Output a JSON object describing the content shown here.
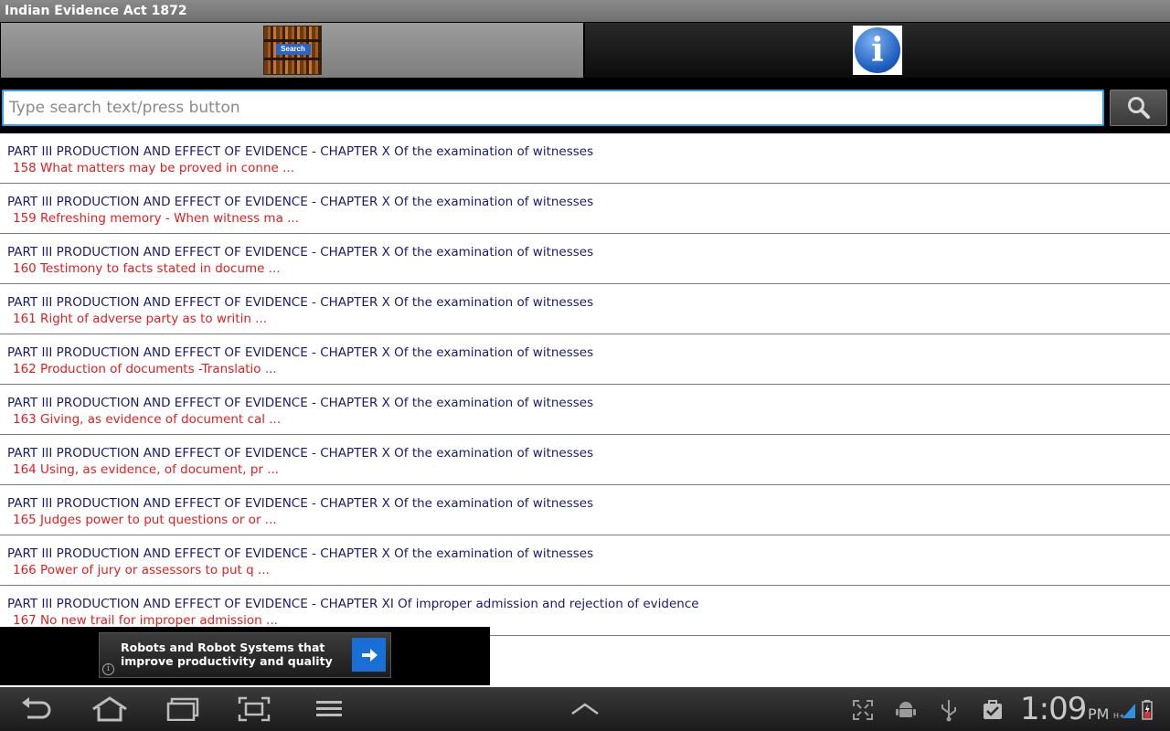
{
  "app": {
    "title": "Indian Evidence Act 1872"
  },
  "tabs": {
    "search_thumb_label": "Search",
    "search_icon": "search-books-icon",
    "info_icon": "info-icon"
  },
  "search": {
    "placeholder": "Type search text/press button",
    "value": ""
  },
  "colors": {
    "title_text": "#1a1a6e",
    "subtitle_text": "#e02020",
    "input_border": "#38a0e0"
  },
  "results": [
    {
      "title": "PART III PRODUCTION AND EFFECT OF EVIDENCE - CHAPTER X Of the examination of witnesses",
      "subtitle": "158 What matters may be proved in conne ..."
    },
    {
      "title": "PART III PRODUCTION AND EFFECT OF EVIDENCE - CHAPTER X Of the examination of witnesses",
      "subtitle": "159 Refreshing memory - When witness ma ..."
    },
    {
      "title": "PART III PRODUCTION AND EFFECT OF EVIDENCE - CHAPTER X Of the examination of witnesses",
      "subtitle": "160 Testimony to facts stated in docume ..."
    },
    {
      "title": "PART III PRODUCTION AND EFFECT OF EVIDENCE - CHAPTER X Of the examination of witnesses",
      "subtitle": "161 Right of adverse party as to writin ..."
    },
    {
      "title": "PART III PRODUCTION AND EFFECT OF EVIDENCE - CHAPTER X Of the examination of witnesses",
      "subtitle": "162 Production of documents -Translatio ..."
    },
    {
      "title": "PART III PRODUCTION AND EFFECT OF EVIDENCE - CHAPTER X Of the examination of witnesses",
      "subtitle": "163 Giving, as evidence of document cal ..."
    },
    {
      "title": "PART III PRODUCTION AND EFFECT OF EVIDENCE - CHAPTER X Of the examination of witnesses",
      "subtitle": "164 Using, as evidence, of document, pr ..."
    },
    {
      "title": "PART III PRODUCTION AND EFFECT OF EVIDENCE - CHAPTER X Of the examination of witnesses",
      "subtitle": "165 Judges power to put questions or or ..."
    },
    {
      "title": "PART III PRODUCTION AND EFFECT OF EVIDENCE - CHAPTER X Of the examination of witnesses",
      "subtitle": "166 Power of jury or assessors to put q ..."
    },
    {
      "title": "PART III PRODUCTION AND EFFECT OF EVIDENCE - CHAPTER XI Of improper admission and rejection of evidence",
      "subtitle": "167 No new trail for improper admission ..."
    }
  ],
  "ad": {
    "text": "Robots and Robot Systems that improve productivity and quality",
    "info_glyph": "i"
  },
  "status": {
    "time": "1:09",
    "ampm": "PM",
    "nav_icons": [
      "back-icon",
      "home-icon",
      "recent-apps-icon",
      "screenshot-icon",
      "menu-icon",
      "chevron-up-icon"
    ],
    "tray_icons": [
      "fullscreen-icon",
      "android-debug-icon",
      "usb-icon",
      "task-done-icon",
      "signal-icon",
      "battery-icon"
    ]
  }
}
